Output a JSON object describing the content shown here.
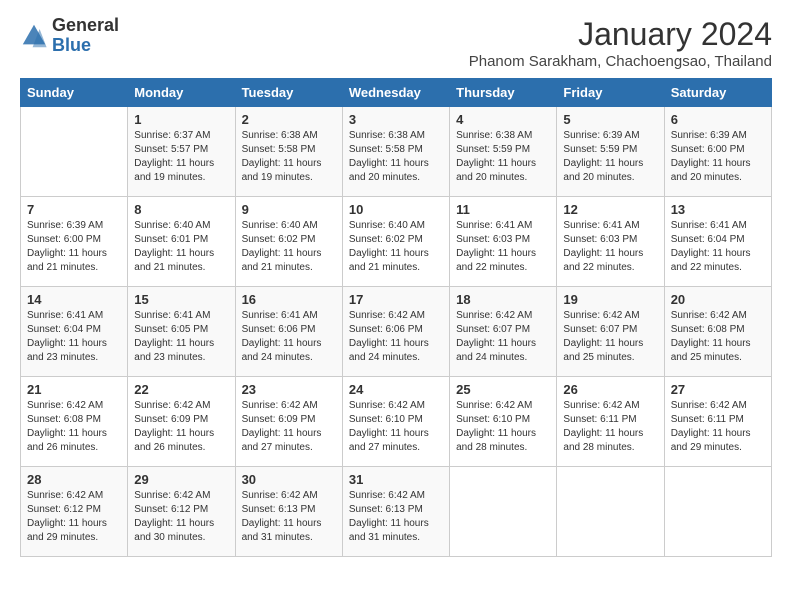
{
  "logo": {
    "general": "General",
    "blue": "Blue"
  },
  "title": "January 2024",
  "location": "Phanom Sarakham, Chachoengsao, Thailand",
  "days_of_week": [
    "Sunday",
    "Monday",
    "Tuesday",
    "Wednesday",
    "Thursday",
    "Friday",
    "Saturday"
  ],
  "weeks": [
    [
      {
        "day": "",
        "info": ""
      },
      {
        "day": "1",
        "info": "Sunrise: 6:37 AM\nSunset: 5:57 PM\nDaylight: 11 hours\nand 19 minutes."
      },
      {
        "day": "2",
        "info": "Sunrise: 6:38 AM\nSunset: 5:58 PM\nDaylight: 11 hours\nand 19 minutes."
      },
      {
        "day": "3",
        "info": "Sunrise: 6:38 AM\nSunset: 5:58 PM\nDaylight: 11 hours\nand 20 minutes."
      },
      {
        "day": "4",
        "info": "Sunrise: 6:38 AM\nSunset: 5:59 PM\nDaylight: 11 hours\nand 20 minutes."
      },
      {
        "day": "5",
        "info": "Sunrise: 6:39 AM\nSunset: 5:59 PM\nDaylight: 11 hours\nand 20 minutes."
      },
      {
        "day": "6",
        "info": "Sunrise: 6:39 AM\nSunset: 6:00 PM\nDaylight: 11 hours\nand 20 minutes."
      }
    ],
    [
      {
        "day": "7",
        "info": "Sunrise: 6:39 AM\nSunset: 6:00 PM\nDaylight: 11 hours\nand 21 minutes."
      },
      {
        "day": "8",
        "info": "Sunrise: 6:40 AM\nSunset: 6:01 PM\nDaylight: 11 hours\nand 21 minutes."
      },
      {
        "day": "9",
        "info": "Sunrise: 6:40 AM\nSunset: 6:02 PM\nDaylight: 11 hours\nand 21 minutes."
      },
      {
        "day": "10",
        "info": "Sunrise: 6:40 AM\nSunset: 6:02 PM\nDaylight: 11 hours\nand 21 minutes."
      },
      {
        "day": "11",
        "info": "Sunrise: 6:41 AM\nSunset: 6:03 PM\nDaylight: 11 hours\nand 22 minutes."
      },
      {
        "day": "12",
        "info": "Sunrise: 6:41 AM\nSunset: 6:03 PM\nDaylight: 11 hours\nand 22 minutes."
      },
      {
        "day": "13",
        "info": "Sunrise: 6:41 AM\nSunset: 6:04 PM\nDaylight: 11 hours\nand 22 minutes."
      }
    ],
    [
      {
        "day": "14",
        "info": "Sunrise: 6:41 AM\nSunset: 6:04 PM\nDaylight: 11 hours\nand 23 minutes."
      },
      {
        "day": "15",
        "info": "Sunrise: 6:41 AM\nSunset: 6:05 PM\nDaylight: 11 hours\nand 23 minutes."
      },
      {
        "day": "16",
        "info": "Sunrise: 6:41 AM\nSunset: 6:06 PM\nDaylight: 11 hours\nand 24 minutes."
      },
      {
        "day": "17",
        "info": "Sunrise: 6:42 AM\nSunset: 6:06 PM\nDaylight: 11 hours\nand 24 minutes."
      },
      {
        "day": "18",
        "info": "Sunrise: 6:42 AM\nSunset: 6:07 PM\nDaylight: 11 hours\nand 24 minutes."
      },
      {
        "day": "19",
        "info": "Sunrise: 6:42 AM\nSunset: 6:07 PM\nDaylight: 11 hours\nand 25 minutes."
      },
      {
        "day": "20",
        "info": "Sunrise: 6:42 AM\nSunset: 6:08 PM\nDaylight: 11 hours\nand 25 minutes."
      }
    ],
    [
      {
        "day": "21",
        "info": "Sunrise: 6:42 AM\nSunset: 6:08 PM\nDaylight: 11 hours\nand 26 minutes."
      },
      {
        "day": "22",
        "info": "Sunrise: 6:42 AM\nSunset: 6:09 PM\nDaylight: 11 hours\nand 26 minutes."
      },
      {
        "day": "23",
        "info": "Sunrise: 6:42 AM\nSunset: 6:09 PM\nDaylight: 11 hours\nand 27 minutes."
      },
      {
        "day": "24",
        "info": "Sunrise: 6:42 AM\nSunset: 6:10 PM\nDaylight: 11 hours\nand 27 minutes."
      },
      {
        "day": "25",
        "info": "Sunrise: 6:42 AM\nSunset: 6:10 PM\nDaylight: 11 hours\nand 28 minutes."
      },
      {
        "day": "26",
        "info": "Sunrise: 6:42 AM\nSunset: 6:11 PM\nDaylight: 11 hours\nand 28 minutes."
      },
      {
        "day": "27",
        "info": "Sunrise: 6:42 AM\nSunset: 6:11 PM\nDaylight: 11 hours\nand 29 minutes."
      }
    ],
    [
      {
        "day": "28",
        "info": "Sunrise: 6:42 AM\nSunset: 6:12 PM\nDaylight: 11 hours\nand 29 minutes."
      },
      {
        "day": "29",
        "info": "Sunrise: 6:42 AM\nSunset: 6:12 PM\nDaylight: 11 hours\nand 30 minutes."
      },
      {
        "day": "30",
        "info": "Sunrise: 6:42 AM\nSunset: 6:13 PM\nDaylight: 11 hours\nand 31 minutes."
      },
      {
        "day": "31",
        "info": "Sunrise: 6:42 AM\nSunset: 6:13 PM\nDaylight: 11 hours\nand 31 minutes."
      },
      {
        "day": "",
        "info": ""
      },
      {
        "day": "",
        "info": ""
      },
      {
        "day": "",
        "info": ""
      }
    ]
  ]
}
